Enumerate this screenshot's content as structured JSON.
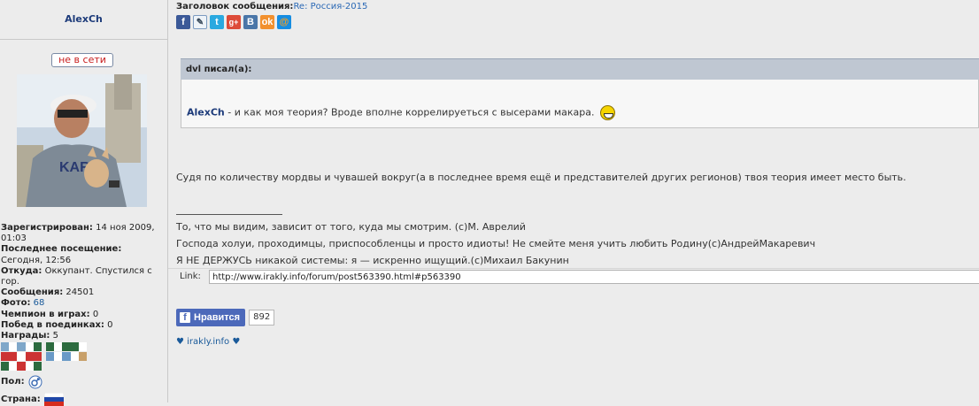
{
  "profile": {
    "nickname": "AlexCh",
    "status": "не в сети",
    "registered_label": "Зарегистрирован:",
    "registered_value": "14 ноя 2009, 01:03",
    "last_visit_label": "Последнее посещение:",
    "last_visit_value": "Сегодня, 12:56",
    "from_label": "Откуда:",
    "from_value": "Оккупант. Спустился с гор.",
    "messages_label": "Сообщения:",
    "messages_value": "24501",
    "photo_label": "Фото:",
    "photo_value": "68",
    "champion_label": "Чемпион в играх:",
    "champion_value": "0",
    "duels_label": "Побед в поединках:",
    "duels_value": "0",
    "awards_label": "Награды:",
    "awards_value": "5",
    "gender_label": "Пол:",
    "gender_icon": "male-symbol-icon",
    "country_label": "Страна:",
    "country_flag": "russia-flag-icon"
  },
  "post": {
    "subject_label": "Заголовок сообщения:",
    "subject_value": "Re: Россия-2015",
    "share_icons": [
      "facebook-icon",
      "livejournal-icon",
      "twitter-icon",
      "googleplus-icon",
      "vkontakte-icon",
      "odnoklassniki-icon",
      "mailru-icon"
    ],
    "quote_author": "dvl писал(а):",
    "quote_name": "AlexCh",
    "quote_text": " - и как моя теория? Вроде вполне коррелируеться с высерами макара.",
    "body": "Судя по количеству мордвы и чувашей вокруг(а в последнее время ещё и представителей других регионов) твоя теория имеет место быть.",
    "signature": [
      "То, что мы видим, зависит от того, куда мы смотрим. (с)М. Аврелий",
      "Господа холуи, проходимцы, приспособленцы и просто идиоты! Не смейте меня учить любить Родину(с)АндрейМакаревич",
      "Я НЕ ДЕРЖУСЬ никакой системы: я — искренно ищущий.(с)Михаил Бакунин"
    ],
    "link_label": "Link:",
    "link_value": "http://www.irakly.info/forum/post563390.html#p563390",
    "like_label": "Нравится",
    "like_count": "892",
    "site_link": "♥ irakly.info ♥"
  },
  "colors": {
    "accent": "#1d3b7a",
    "offline": "#c71c1c",
    "facebook": "#4c69ba"
  }
}
